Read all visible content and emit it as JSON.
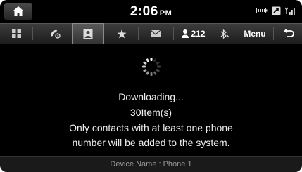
{
  "status_bar": {
    "time": "2:06",
    "ampm": "PM"
  },
  "tabs": {
    "contacts_count": "212",
    "menu_label": "Menu"
  },
  "message": {
    "downloading": "Downloading...",
    "item_count": "30",
    "item_unit": "Item(s)",
    "note_line1": "Only contacts with at least one phone",
    "note_line2": "number will be added to the system."
  },
  "footer": {
    "device_name": "Device Name : Phone 1"
  },
  "icons": [
    "home-icon",
    "battery-icon",
    "message-status-icon",
    "signal-icon",
    "grid-icon",
    "call-history-icon",
    "contacts-icon",
    "favorites-icon",
    "messages-icon",
    "person-icon",
    "bluetooth-icon",
    "back-icon",
    "loading-spinner-icon"
  ]
}
